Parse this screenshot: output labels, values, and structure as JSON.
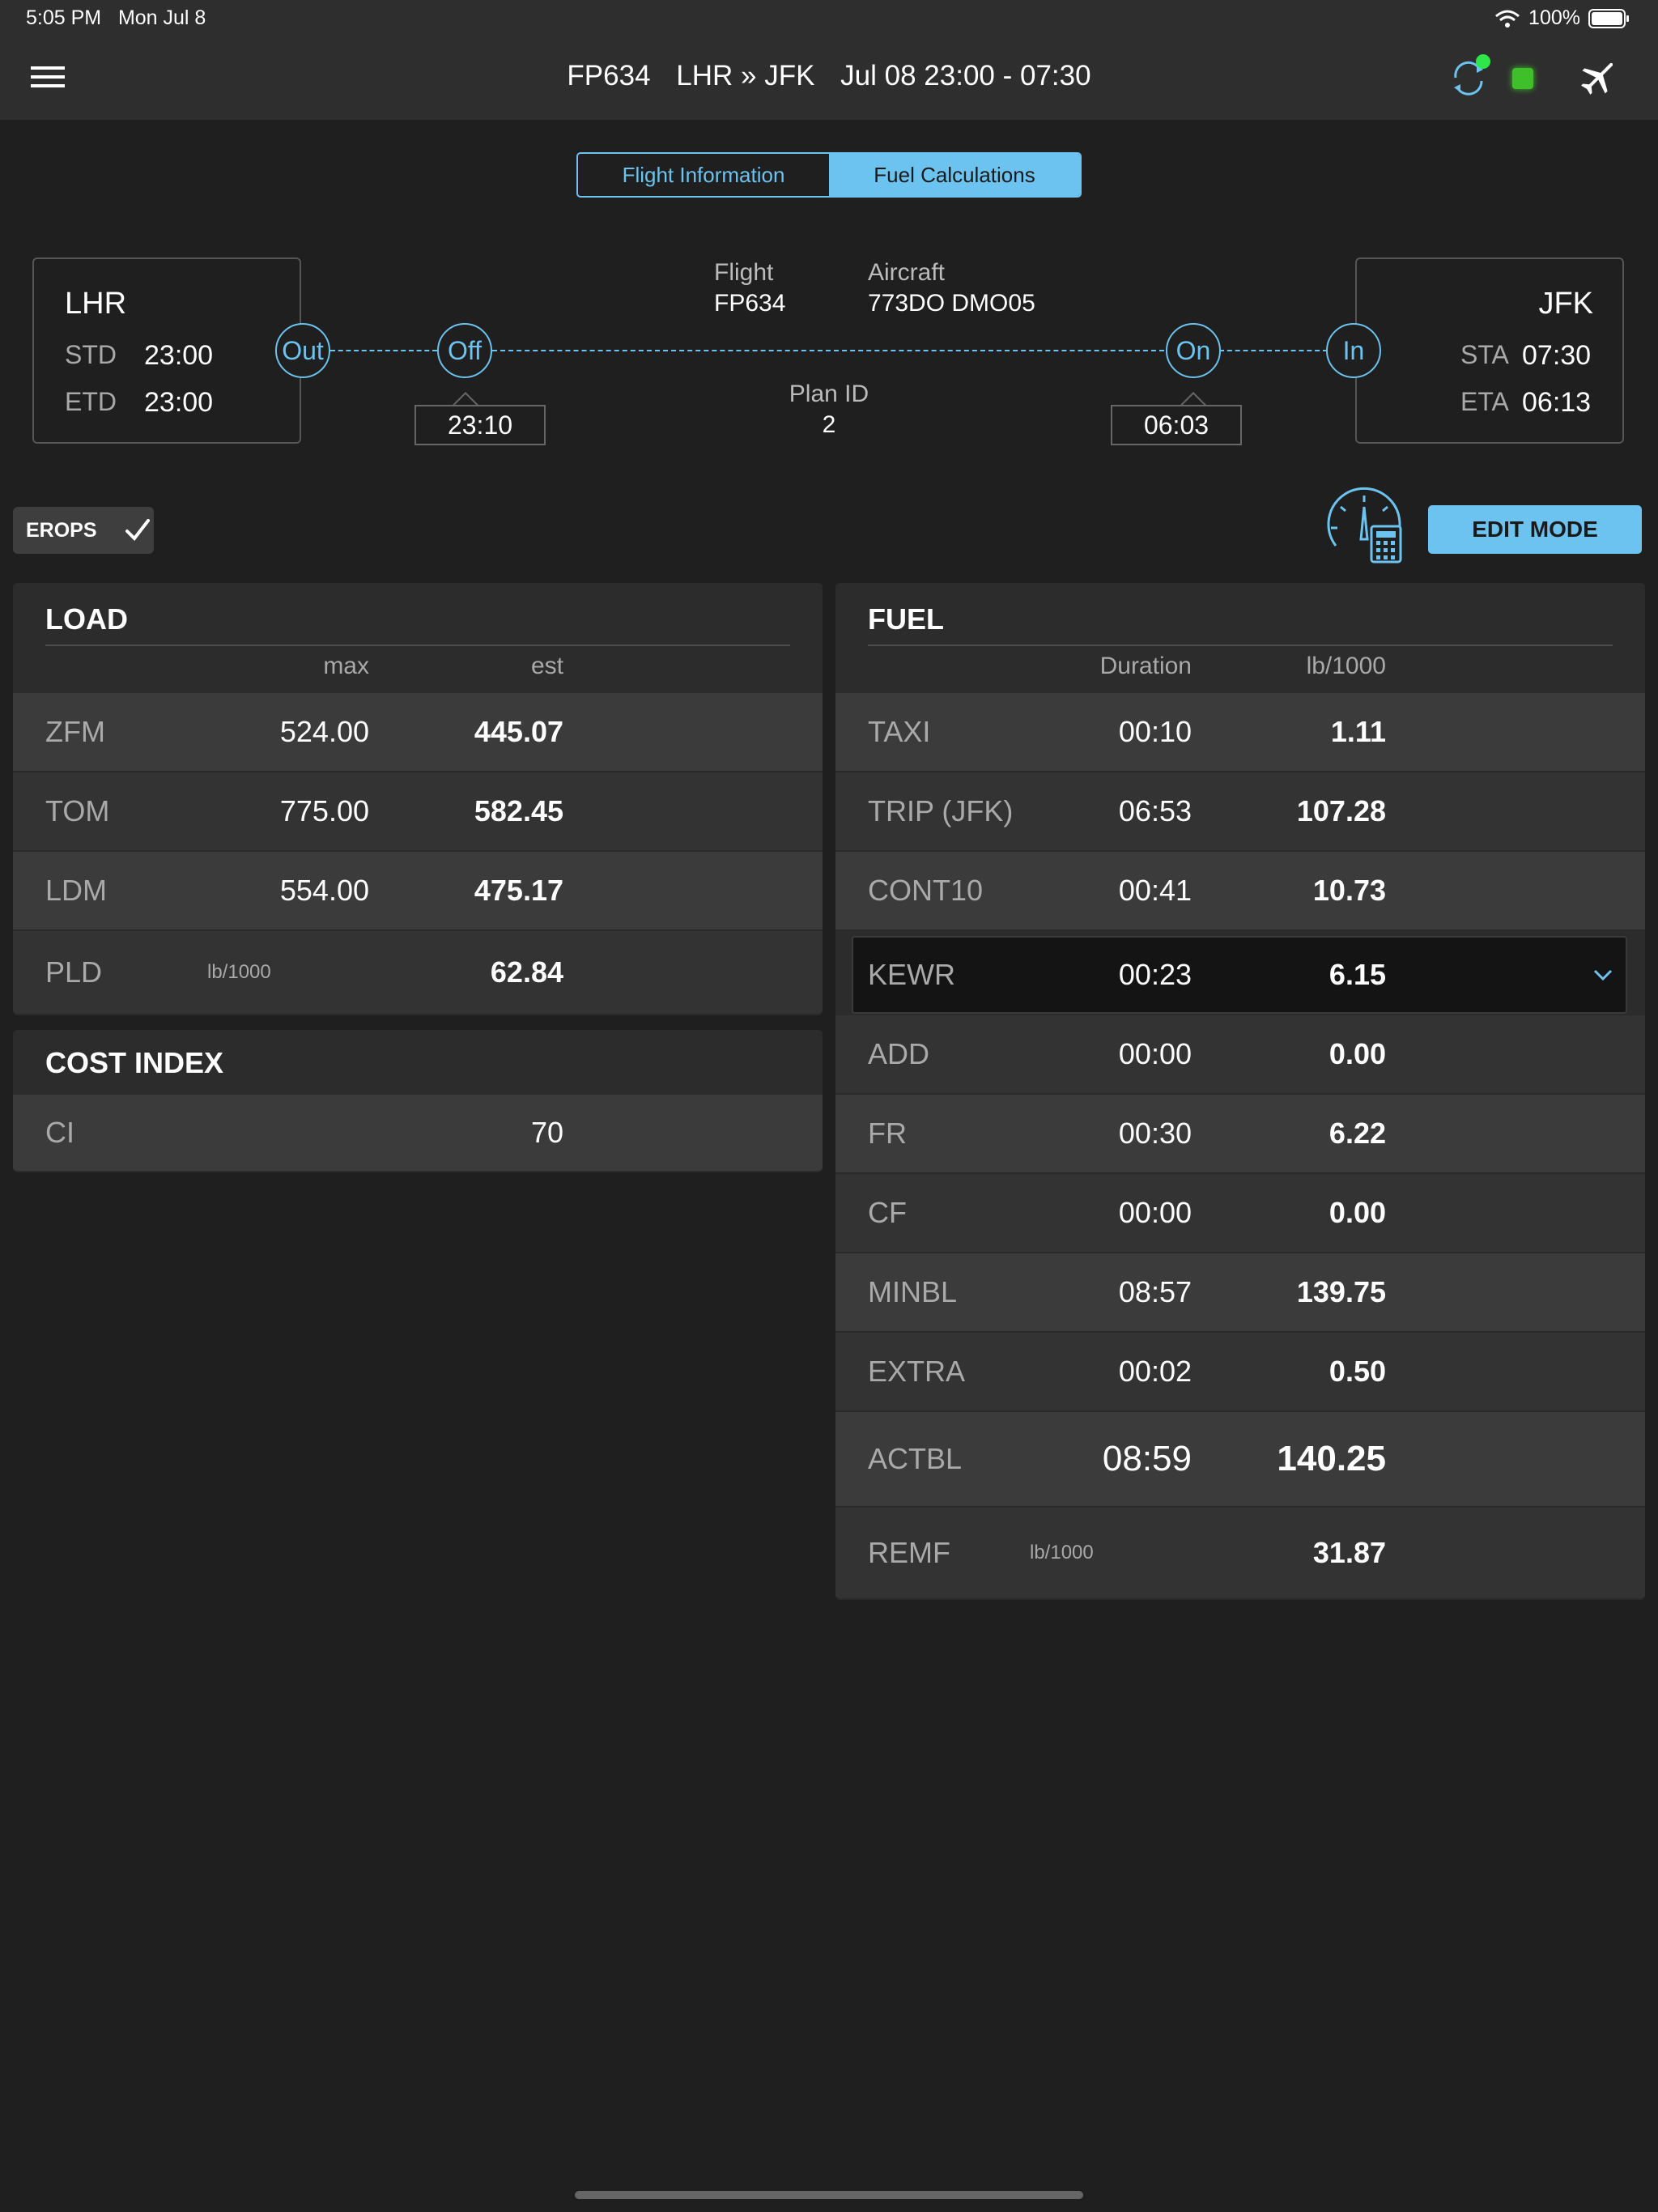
{
  "status": {
    "time": "5:05 PM",
    "date": "Mon Jul 8",
    "battery": "100%"
  },
  "header": {
    "flight": "FP634",
    "route": "LHR » JFK",
    "schedule": "Jul 08 23:00 - 07:30"
  },
  "tabs": [
    {
      "label": "Flight Information",
      "active": false
    },
    {
      "label": "Fuel Calculations",
      "active": true
    }
  ],
  "departure": {
    "code": "LHR",
    "std_label": "STD",
    "std": "23:00",
    "etd_label": "ETD",
    "etd": "23:00"
  },
  "arrival": {
    "code": "JFK",
    "sta_label": "STA",
    "sta": "07:30",
    "eta_label": "ETA",
    "eta": "06:13"
  },
  "timeline": {
    "out": "Out",
    "off": "Off",
    "on": "On",
    "in": "In",
    "off_time": "23:10",
    "on_time": "06:03"
  },
  "flight_info": {
    "flight_label": "Flight",
    "flight": "FP634",
    "aircraft_label": "Aircraft",
    "aircraft": "773DO DMO05",
    "plan_label": "Plan ID",
    "plan_id": "2"
  },
  "erops": {
    "label": "EROPS",
    "checked": true
  },
  "edit_mode": "EDIT MODE",
  "load": {
    "title": "LOAD",
    "col_max": "max",
    "col_est": "est",
    "rows": [
      {
        "label": "ZFM",
        "max": "524.00",
        "est": "445.07"
      },
      {
        "label": "TOM",
        "max": "775.00",
        "est": "582.45"
      },
      {
        "label": "LDM",
        "max": "554.00",
        "est": "475.17"
      },
      {
        "label": "PLD",
        "unit": "lb/1000",
        "est": "62.84"
      }
    ]
  },
  "cost_index": {
    "title": "COST INDEX",
    "label": "CI",
    "value": "70"
  },
  "fuel": {
    "title": "FUEL",
    "col_duration": "Duration",
    "col_unit": "lb/1000",
    "rows": [
      {
        "label": "TAXI",
        "duration": "00:10",
        "value": "1.11"
      },
      {
        "label": "TRIP (JFK)",
        "duration": "06:53",
        "value": "107.28"
      },
      {
        "label": "CONT10",
        "duration": "00:41",
        "value": "10.73"
      },
      {
        "label": "KEWR",
        "duration": "00:23",
        "value": "6.15"
      },
      {
        "label": "ADD",
        "duration": "00:00",
        "value": "0.00"
      },
      {
        "label": "FR",
        "duration": "00:30",
        "value": "6.22"
      },
      {
        "label": "CF",
        "duration": "00:00",
        "value": "0.00"
      },
      {
        "label": "MINBL",
        "duration": "08:57",
        "value": "139.75"
      },
      {
        "label": "EXTRA",
        "duration": "00:02",
        "value": "0.50"
      },
      {
        "label": "ACTBL",
        "duration": "08:59",
        "value": "140.25"
      },
      {
        "label": "REMF",
        "unit": "lb/1000",
        "value": "31.87"
      }
    ]
  },
  "colors": {
    "accent": "#6cc3f0",
    "sync_dot": "#2ee64a",
    "status_square": "#3fbf2a"
  }
}
